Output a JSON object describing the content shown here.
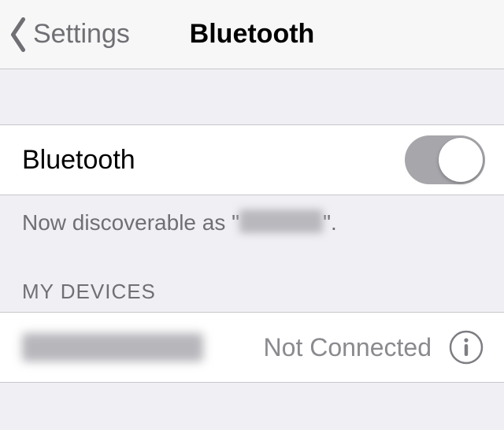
{
  "nav": {
    "back_label": "Settings",
    "title": "Bluetooth"
  },
  "toggle_row": {
    "label": "Bluetooth",
    "on": true
  },
  "discoverable": {
    "prefix": "Now discoverable as \"",
    "suffix": "\"."
  },
  "section_header": "MY DEVICES",
  "device": {
    "status": "Not Connected"
  }
}
